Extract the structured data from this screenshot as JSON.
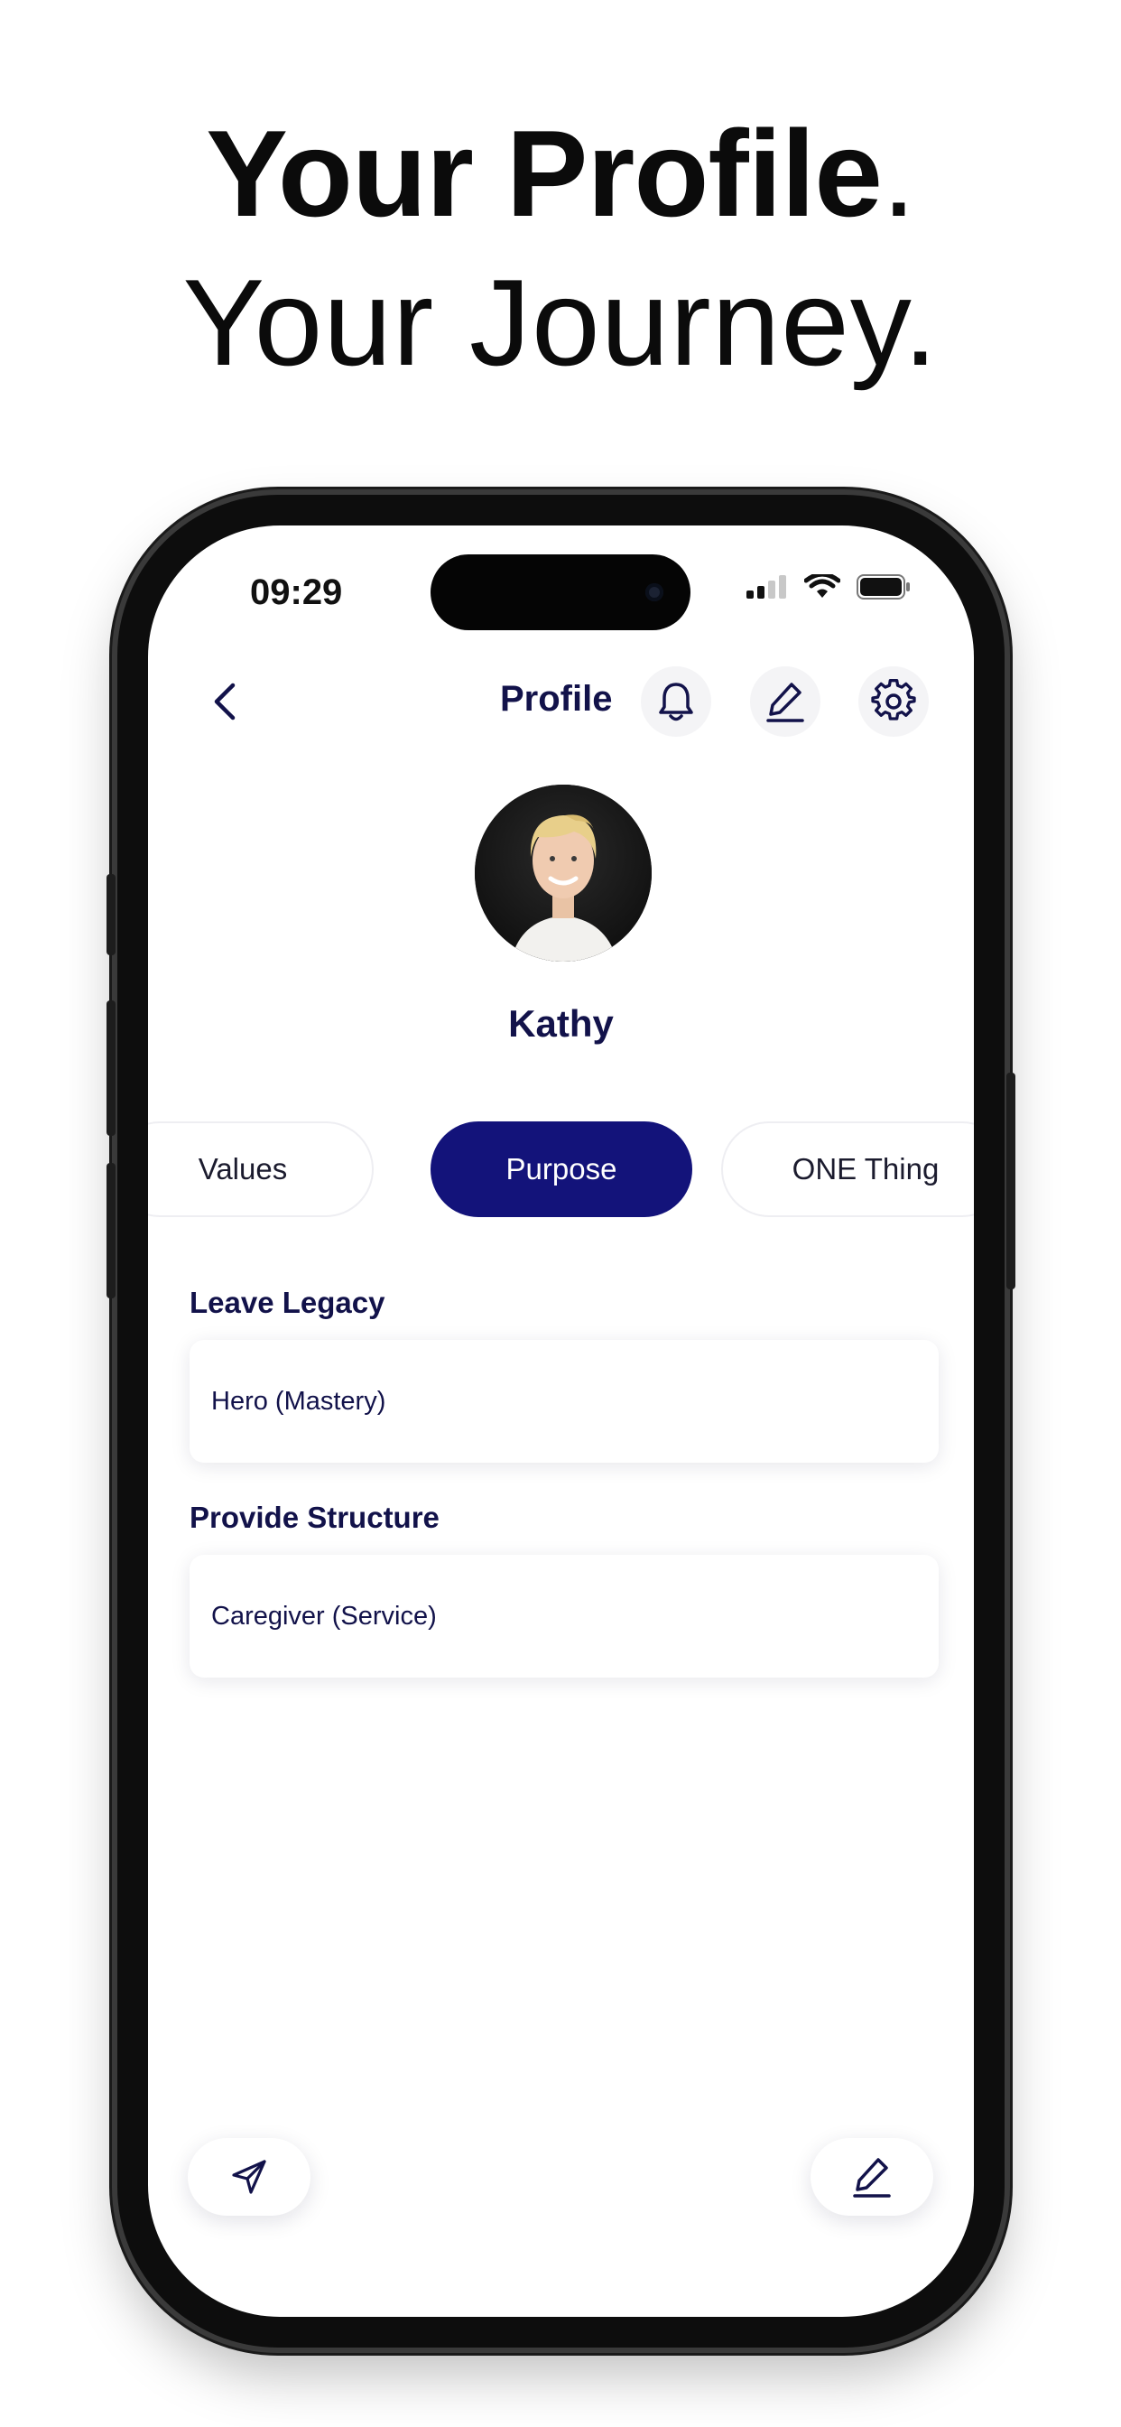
{
  "headline": {
    "line1_bold": "Your Profile",
    "line1_period": ".",
    "line2": "Your Journey."
  },
  "status_bar": {
    "time": "09:29",
    "icons": [
      "cellular-signal-icon",
      "wifi-icon",
      "battery-icon"
    ]
  },
  "header": {
    "title": "Profile",
    "icons": [
      "back-chevron-icon",
      "bell-icon",
      "edit-pencil-icon",
      "gear-icon"
    ]
  },
  "profile": {
    "name": "Kathy",
    "avatar": "avatar"
  },
  "tabs": [
    {
      "label": "Values",
      "active": false
    },
    {
      "label": "Purpose",
      "active": true
    },
    {
      "label": "ONE Thing",
      "active": false
    }
  ],
  "sections": [
    {
      "label": "Leave Legacy",
      "value": "Hero (Mastery)"
    },
    {
      "label": "Provide Structure",
      "value": "Caregiver (Service)"
    }
  ],
  "footer": {
    "left_icon": "send-icon",
    "right_icon": "edit-pencil-icon"
  },
  "colors": {
    "accent": "#13137a",
    "text_dark": "#12124a",
    "background": "#ffffff"
  }
}
